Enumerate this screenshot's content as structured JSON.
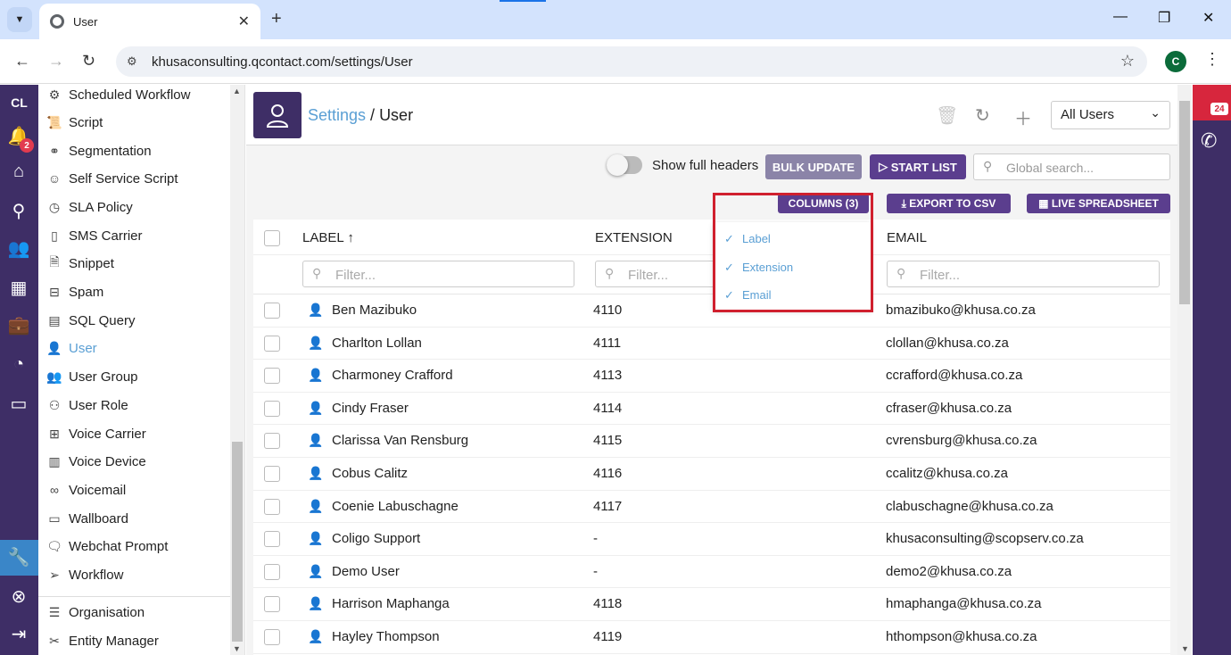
{
  "browser": {
    "tab_title": "User",
    "url": "khusaconsulting.qcontact.com/settings/User",
    "profile_initial": "C"
  },
  "rail": {
    "logo_text": "CL",
    "notification_count": "2"
  },
  "right_rail": {
    "badge_count": "24"
  },
  "sidebar": {
    "items": [
      {
        "label": "Scheduled Workflow",
        "icon": "workflow-clock-icon"
      },
      {
        "label": "Script",
        "icon": "script-icon"
      },
      {
        "label": "Segmentation",
        "icon": "segmentation-icon"
      },
      {
        "label": "Self Service Script",
        "icon": "robot-icon"
      },
      {
        "label": "SLA Policy",
        "icon": "sla-icon"
      },
      {
        "label": "SMS Carrier",
        "icon": "mobile-icon"
      },
      {
        "label": "Snippet",
        "icon": "snippet-icon"
      },
      {
        "label": "Spam",
        "icon": "spam-icon"
      },
      {
        "label": "SQL Query",
        "icon": "table-icon"
      },
      {
        "label": "User",
        "icon": "user-icon"
      },
      {
        "label": "User Group",
        "icon": "user-group-icon"
      },
      {
        "label": "User Role",
        "icon": "user-role-icon"
      },
      {
        "label": "Voice Carrier",
        "icon": "network-icon"
      },
      {
        "label": "Voice Device",
        "icon": "device-icon"
      },
      {
        "label": "Voicemail",
        "icon": "voicemail-icon"
      },
      {
        "label": "Wallboard",
        "icon": "monitor-icon"
      },
      {
        "label": "Webchat Prompt",
        "icon": "chat-icon"
      },
      {
        "label": "Workflow",
        "icon": "send-icon"
      }
    ],
    "bottom_items": [
      {
        "label": "Organisation",
        "icon": "sliders-icon"
      },
      {
        "label": "Entity Manager",
        "icon": "tools-icon"
      }
    ]
  },
  "header": {
    "breadcrumb_link": "Settings",
    "breadcrumb_sep": " / ",
    "breadcrumb_current": "User",
    "filter_select": "All Users"
  },
  "toolbar": {
    "toggle_label": "Show full headers",
    "bulk_update": "BULK UPDATE",
    "start_list": "START LIST",
    "search_placeholder": "Global search...",
    "columns": "COLUMNS (3)",
    "export": "EXPORT TO CSV",
    "live_spreadsheet": "LIVE SPREADSHEET"
  },
  "columns_menu": {
    "options": [
      "Label",
      "Extension",
      "Email"
    ]
  },
  "table": {
    "headers": {
      "label": "LABEL",
      "extension": "EXTENSION",
      "email": "EMAIL"
    },
    "filter_placeholder": "Filter...",
    "rows": [
      {
        "label": "Ben Mazibuko",
        "extension": "4110",
        "email": "bmazibuko@khusa.co.za"
      },
      {
        "label": "Charlton Lollan",
        "extension": "4111",
        "email": "clollan@khusa.co.za"
      },
      {
        "label": "Charmoney Crafford",
        "extension": "4113",
        "email": "ccrafford@khusa.co.za"
      },
      {
        "label": "Cindy Fraser",
        "extension": "4114",
        "email": "cfraser@khusa.co.za"
      },
      {
        "label": "Clarissa Van Rensburg",
        "extension": "4115",
        "email": "cvrensburg@khusa.co.za"
      },
      {
        "label": "Cobus Calitz",
        "extension": "4116",
        "email": "ccalitz@khusa.co.za"
      },
      {
        "label": "Coenie Labuschagne",
        "extension": "4117",
        "email": "clabuschagne@khusa.co.za"
      },
      {
        "label": "Coligo Support",
        "extension": "-",
        "email": "khusaconsulting@scopserv.co.za"
      },
      {
        "label": "Demo User",
        "extension": "-",
        "email": "demo2@khusa.co.za"
      },
      {
        "label": "Harrison Maphanga",
        "extension": "4118",
        "email": "hmaphanga@khusa.co.za"
      },
      {
        "label": "Hayley Thompson",
        "extension": "4119",
        "email": "hthompson@khusa.co.za"
      }
    ]
  },
  "colors": {
    "brand_purple": "#3e2e66",
    "button_purple": "#5b3e8e",
    "link_blue": "#5a9fd4",
    "highlight_red": "#d0202e"
  }
}
